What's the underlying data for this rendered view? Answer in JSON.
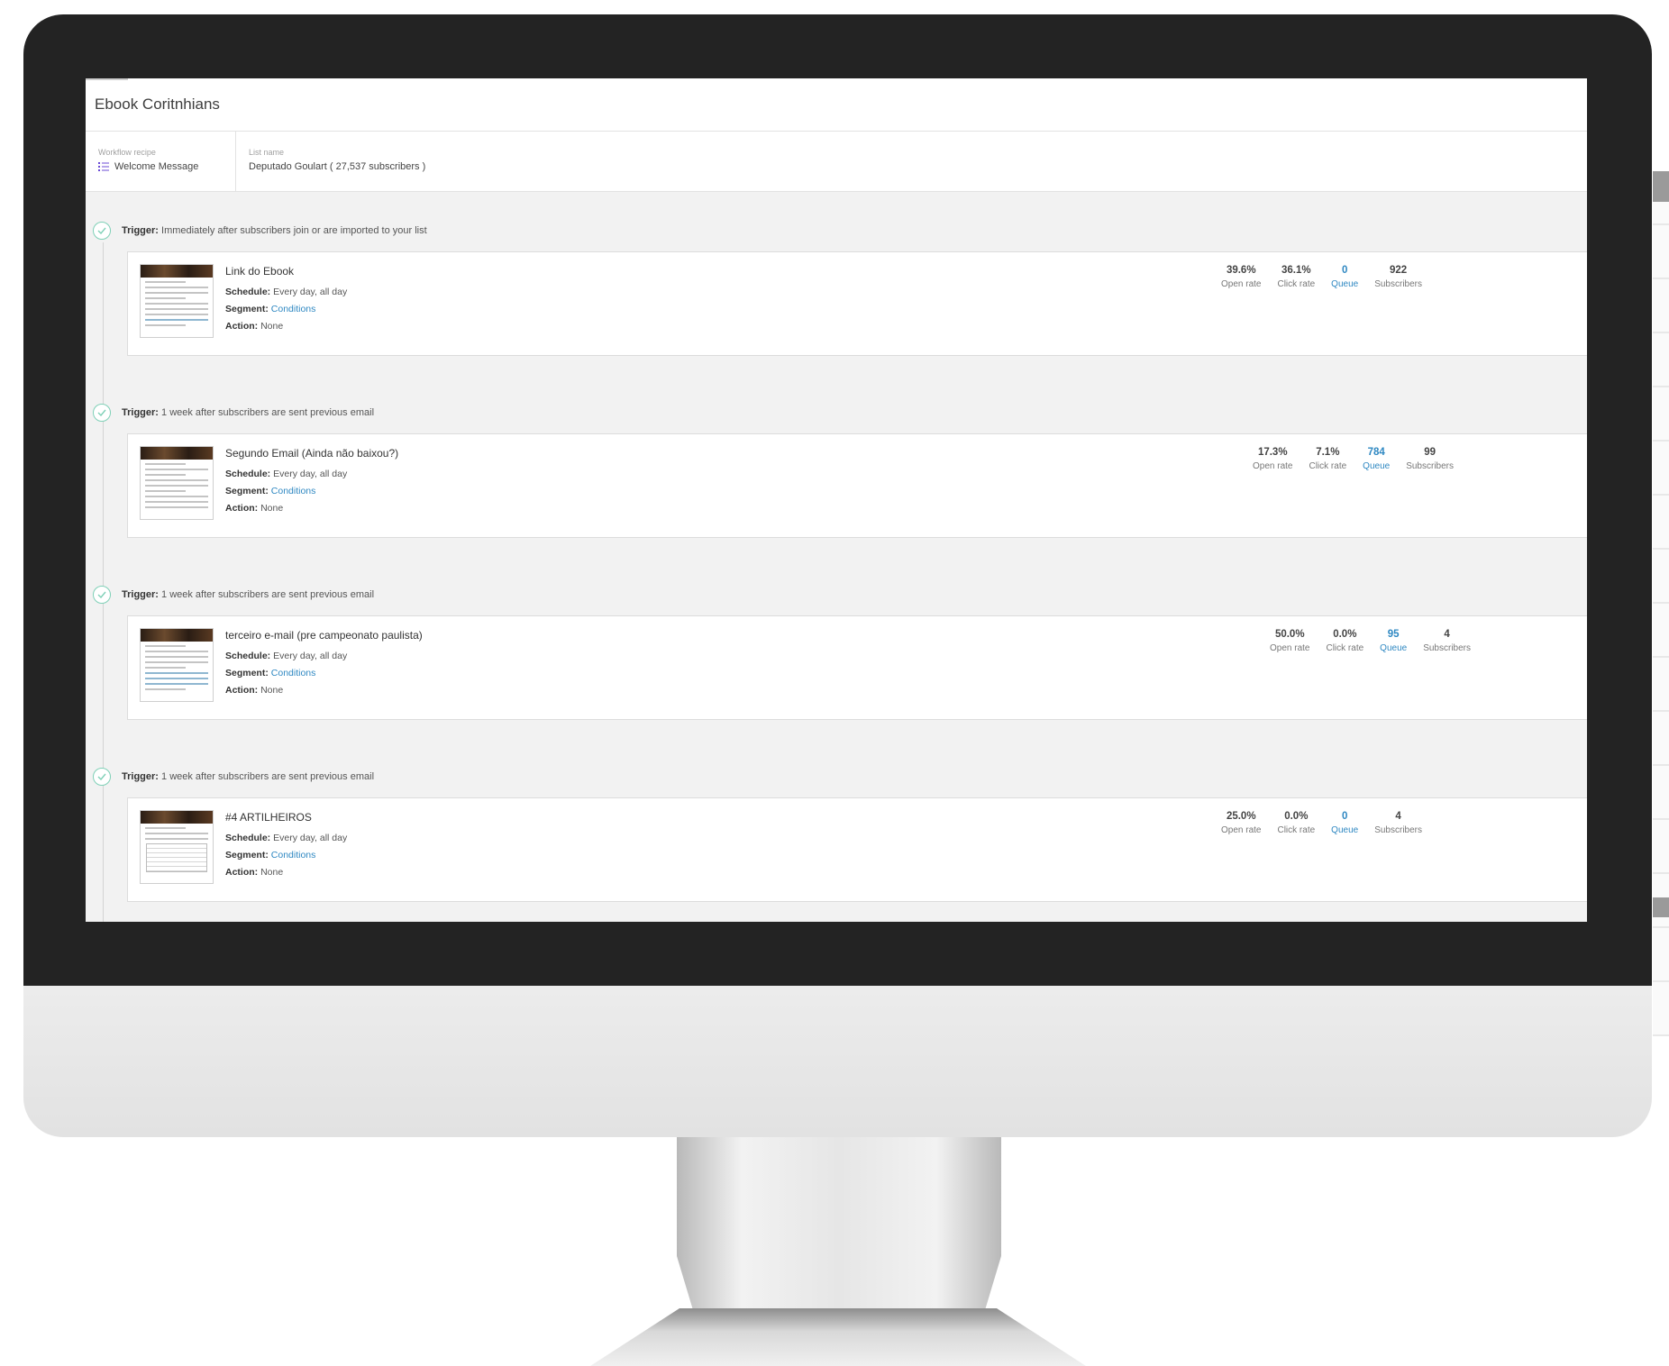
{
  "workflow": {
    "title": "Ebook Coritnhians",
    "recipe_label": "Workflow recipe",
    "recipe_value": "Welcome Message",
    "list_label": "List name",
    "list_value": "Deputado Goulart ( 27,537 subscribers )"
  },
  "labels": {
    "trigger": "Trigger:",
    "schedule": "Schedule:",
    "segment": "Segment:",
    "action": "Action:",
    "open_rate": "Open rate",
    "click_rate": "Click rate",
    "queue": "Queue",
    "subscribers": "Subscribers"
  },
  "steps": [
    {
      "trigger": "Immediately after subscribers join or are imported to your list",
      "email_name": "Link do Ebook",
      "schedule": "Every day, all day",
      "segment": "Conditions",
      "action": "None",
      "open_rate": "39.6%",
      "click_rate": "36.1%",
      "queue": "0",
      "subscribers": "922"
    },
    {
      "trigger": "1 week after subscribers are sent previous email",
      "email_name": "Segundo Email (Ainda não baixou?)",
      "schedule": "Every day, all day",
      "segment": "Conditions",
      "action": "None",
      "open_rate": "17.3%",
      "click_rate": "7.1%",
      "queue": "784",
      "subscribers": "99"
    },
    {
      "trigger": "1 week after subscribers are sent previous email",
      "email_name": "terceiro e-mail (pre campeonato paulista)",
      "schedule": "Every day, all day",
      "segment": "Conditions",
      "action": "None",
      "open_rate": "50.0%",
      "click_rate": "0.0%",
      "queue": "95",
      "subscribers": "4"
    },
    {
      "trigger": "1 week after subscribers are sent previous email",
      "email_name": "#4 ARTILHEIROS",
      "schedule": "Every day, all day",
      "segment": "Conditions",
      "action": "None",
      "open_rate": "25.0%",
      "click_rate": "0.0%",
      "queue": "0",
      "subscribers": "4"
    }
  ],
  "icons": {
    "recipe": "list-icon",
    "trigger_status": "check-circle-icon"
  },
  "colors": {
    "link": "#2f88c2",
    "check": "#7fd0b7",
    "recipe_icon": "#6b4bd6"
  }
}
